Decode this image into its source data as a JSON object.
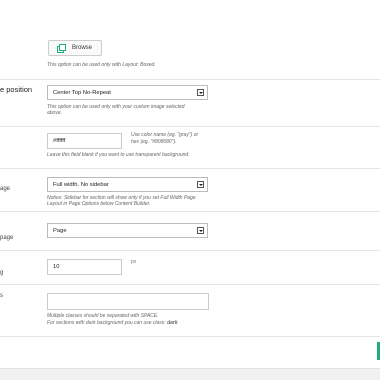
{
  "rows": {
    "image": {
      "label": "",
      "browse_label": "Browse",
      "help": "This option can be used only with Layout: Boxed."
    },
    "position": {
      "label": "e position",
      "select_value": "Center Top No-Repeat",
      "help_line1": "This option can be used only with your custom image selected",
      "help_line2": "above."
    },
    "color": {
      "label": "",
      "value": "#ffffff",
      "side_line1": "Use color name (eg. \"gray\") or",
      "side_line2": "hex (eg. \"#808080\").",
      "help": "Leave this field blank if you want to use transparent background."
    },
    "sidebar": {
      "label": "age",
      "select_value": "Full width. No sidebar",
      "help_line1": "Notice: Sidebar for section will show only if you set Full Width Page",
      "help_line2": "Layout in Page Options below Content Builder."
    },
    "page": {
      "label": "page",
      "select_value": "Page"
    },
    "padding": {
      "label": "g",
      "value": "10",
      "unit": "px"
    },
    "classes": {
      "label": "s",
      "value": "",
      "help_line1": "Multiple classes should be separated with SPACE.",
      "help_line2_prefix": "For sections with dark background you can use class: ",
      "help_line2_bold": "dark"
    }
  },
  "colors": {
    "accent": "#1fae7b",
    "border": "#e5e5e5"
  },
  "icons": {
    "browse": "image-icon"
  }
}
